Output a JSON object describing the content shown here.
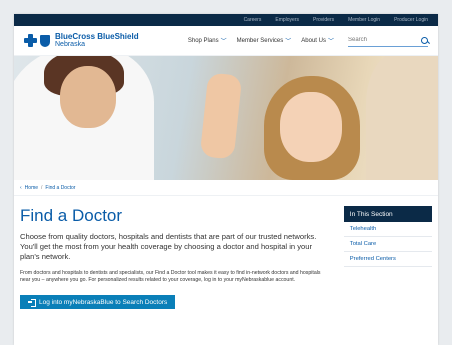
{
  "utility": {
    "items": [
      "Careers",
      "Employers",
      "Providers",
      "Member Login",
      "Producer Login"
    ]
  },
  "header": {
    "logo_line1": "BlueCross BlueShield",
    "logo_line2": "Nebraska",
    "nav": [
      "Shop Plans",
      "Member Services",
      "About Us"
    ],
    "search_placeholder": "Search"
  },
  "breadcrumb": {
    "home": "Home",
    "separator": "/",
    "current": "Find a Doctor"
  },
  "main": {
    "title": "Find a Doctor",
    "lead": "Choose from quality doctors, hospitals and dentists that are part of our trusted networks. You'll get the most from your health coverage by choosing a doctor and hospital in your plan's network.",
    "body": "From doctors and hospitals to dentists and specialists, our Find a Doctor tool makes it easy to find in-network doctors and hospitals near you – anywhere you go. For personalized results related to your coverage, log in to your myNebraskablue account.",
    "login_button": "Log into myNebraskaBlue to Search Doctors"
  },
  "sidebar": {
    "heading": "In This Section",
    "items": [
      "Telehealth",
      "Total Care",
      "Preferred Centers"
    ]
  },
  "colors": {
    "brand_blue": "#0a5ca8",
    "navy": "#0b2a47",
    "button": "#0a7fb8"
  }
}
